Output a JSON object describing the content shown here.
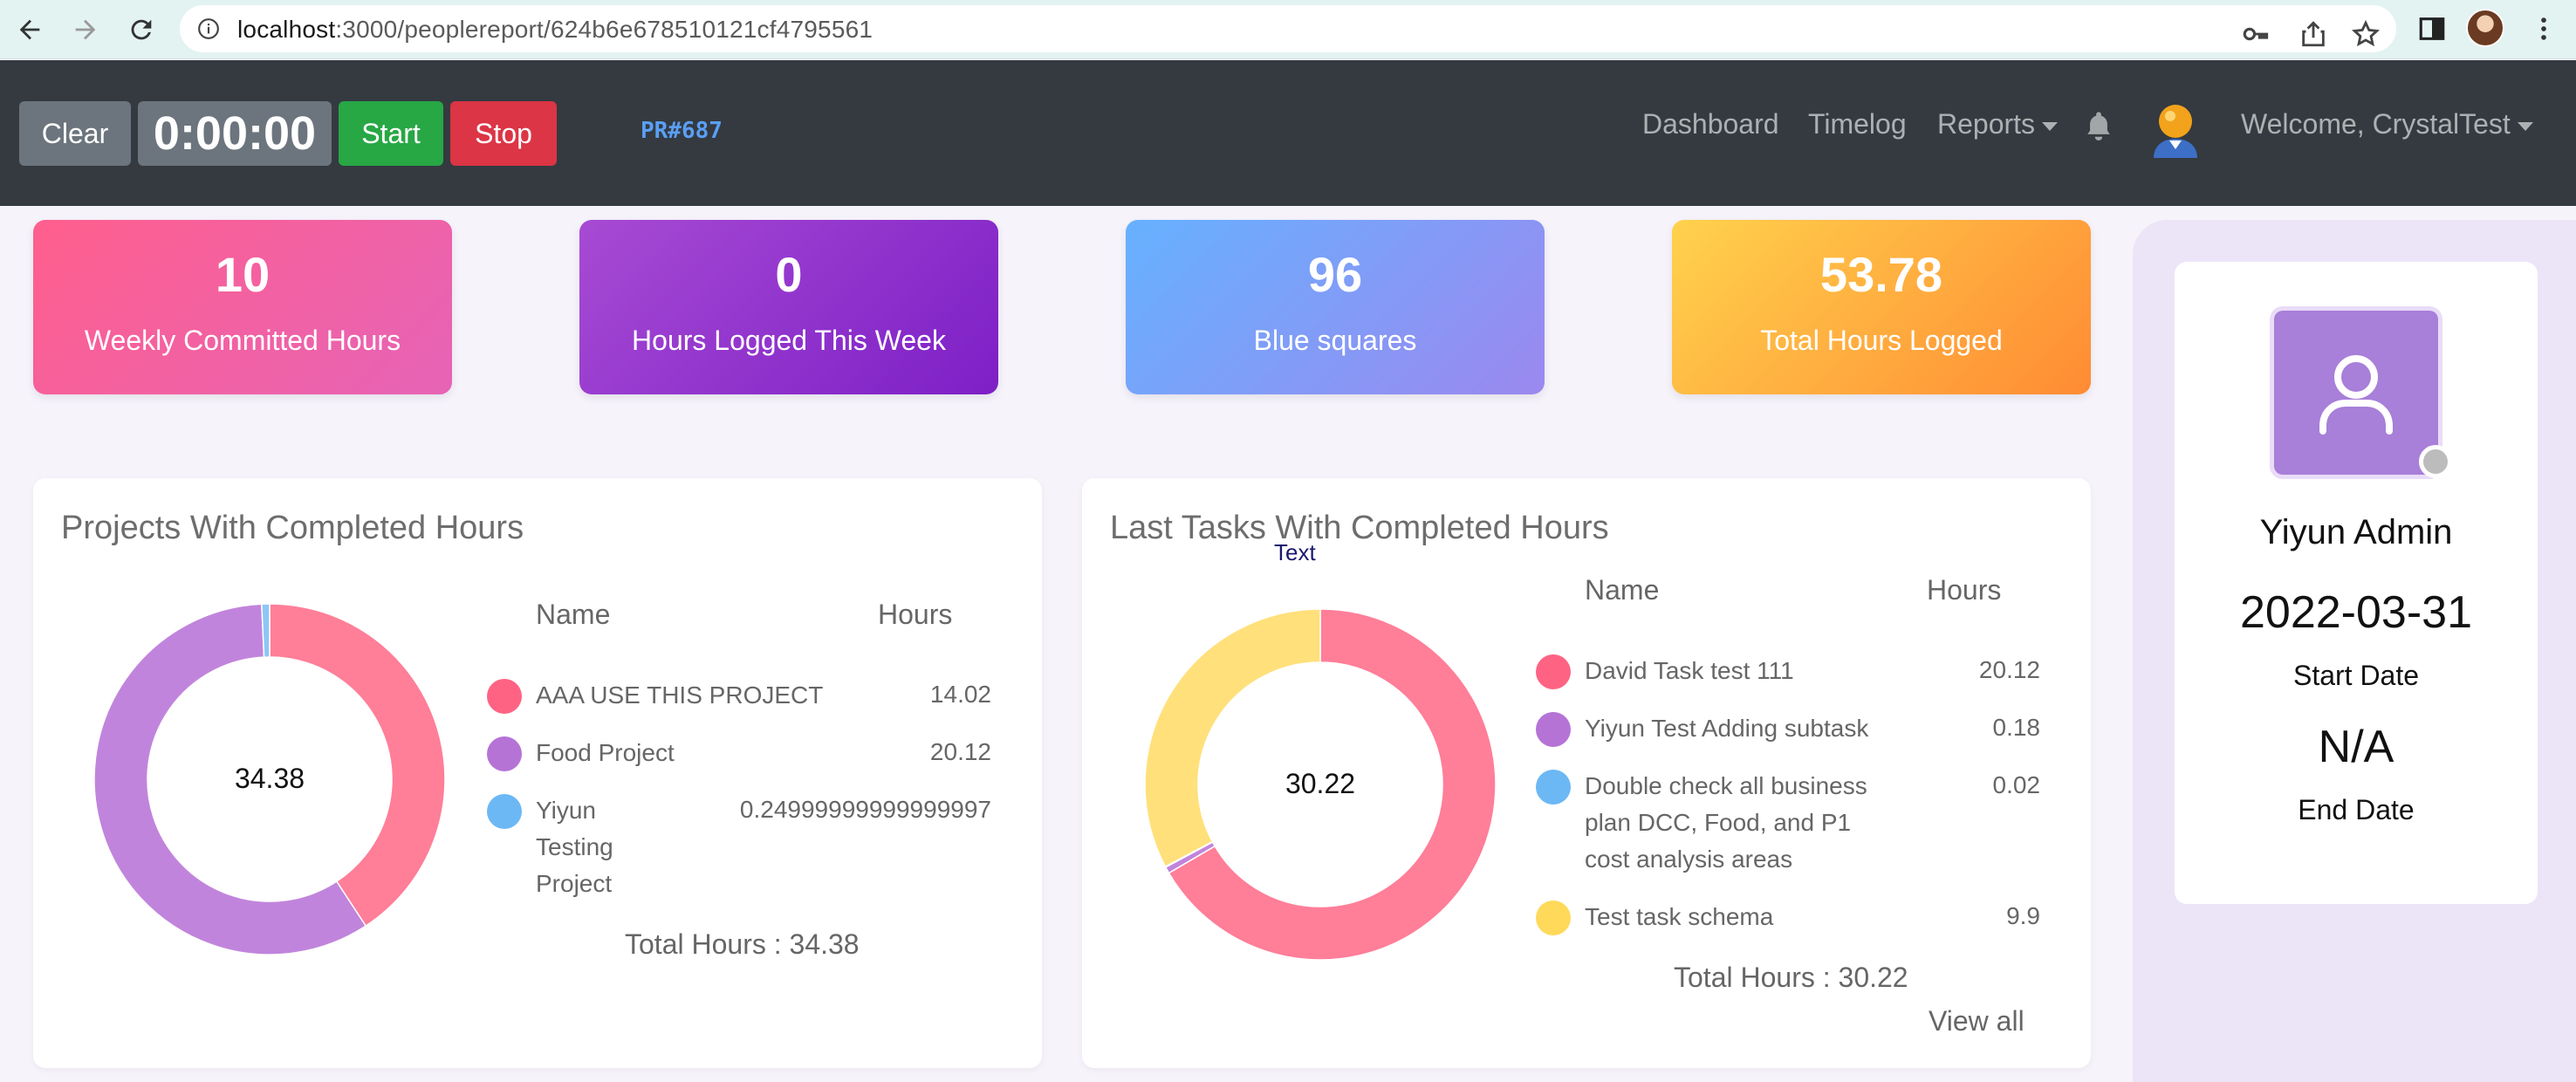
{
  "browser": {
    "url_host": "localhost",
    "url_path": ":3000/peoplereport/624b6e678510121cf4795561",
    "icons": [
      "back-icon",
      "forward-icon",
      "reload-icon",
      "info-icon",
      "key-icon",
      "share-icon",
      "star-icon",
      "sidebar-icon",
      "menu-icon"
    ]
  },
  "navbar": {
    "clear_label": "Clear",
    "timer": "0:00:00",
    "start_label": "Start",
    "stop_label": "Stop",
    "pr_label": "PR#687",
    "links": {
      "dashboard": "Dashboard",
      "timelog": "Timelog",
      "reports": "Reports"
    },
    "welcome": "Welcome, CrystalTest"
  },
  "stats": [
    {
      "value": "10",
      "label": "Weekly Committed Hours"
    },
    {
      "value": "0",
      "label": "Hours Logged This Week"
    },
    {
      "value": "96",
      "label": "Blue squares"
    },
    {
      "value": "53.78",
      "label": "Total Hours Logged"
    }
  ],
  "projects": {
    "title": "Projects With Completed Hours",
    "center": "34.38",
    "col_name": "Name",
    "col_hours": "Hours",
    "rows": [
      {
        "name": "AAA USE THIS PROJECT",
        "hours": "14.02",
        "color": "#ff6384"
      },
      {
        "name": "Food Project",
        "hours": "20.12",
        "color": "#b573d6"
      },
      {
        "name": "Yiyun Testing Project",
        "hours": "0.24999999999999997",
        "color": "#6cb8f5"
      }
    ],
    "total": "Total Hours : 34.38"
  },
  "tasks": {
    "title": "Last Tasks With Completed Hours",
    "text_label": "Text",
    "center": "30.22",
    "col_name": "Name",
    "col_hours": "Hours",
    "rows": [
      {
        "name": "David Task test 111",
        "hours": "20.12",
        "color": "#ff6384"
      },
      {
        "name": "Yiyun Test Adding subtask",
        "hours": "0.18",
        "color": "#b573d6"
      },
      {
        "name": "Double check all business plan DCC, Food, and P1 cost analysis areas",
        "hours": "0.02",
        "color": "#6cb8f5"
      },
      {
        "name": "Test task schema",
        "hours": "9.9",
        "color": "#ffd95a"
      }
    ],
    "total": "Total Hours : 30.22",
    "view_all": "View all"
  },
  "profile": {
    "name": "Yiyun Admin",
    "start_date": "2022-03-31",
    "start_label": "Start Date",
    "end_date": "N/A",
    "end_label": "End Date"
  },
  "chart_data": [
    {
      "type": "pie",
      "title": "Projects With Completed Hours",
      "categories": [
        "AAA USE THIS PROJECT",
        "Food Project",
        "Yiyun Testing Project"
      ],
      "values": [
        14.02,
        20.12,
        0.25
      ],
      "colors": [
        "#ff7e98",
        "#c184dc",
        "#8cc7f5"
      ],
      "center_label": "34.38"
    },
    {
      "type": "pie",
      "title": "Last Tasks With Completed Hours",
      "categories": [
        "David Task test 111",
        "Yiyun Test Adding subtask",
        "Double check all business plan DCC, Food, and P1 cost analysis areas",
        "Test task schema"
      ],
      "values": [
        20.12,
        0.18,
        0.02,
        9.9
      ],
      "colors": [
        "#ff7e98",
        "#c184dc",
        "#8cc7f5",
        "#ffe07a"
      ],
      "center_label": "30.22"
    }
  ]
}
